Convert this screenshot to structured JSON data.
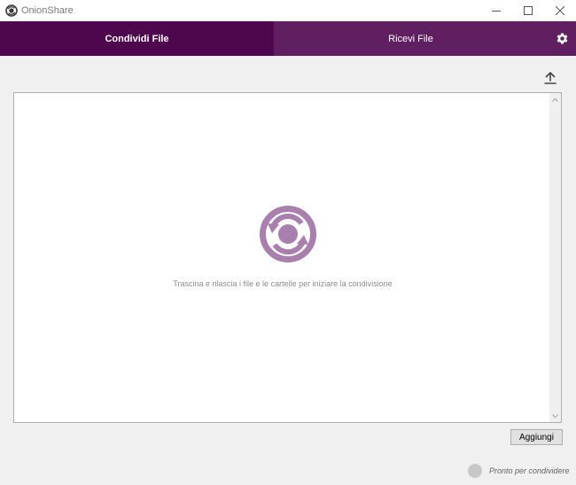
{
  "window": {
    "title": "OnionShare",
    "app_icon": "onionshare-logo-icon",
    "controls": [
      "minimize-icon",
      "maximize-icon",
      "close-icon"
    ]
  },
  "tabs": [
    {
      "label": "Condividi File",
      "active": true
    },
    {
      "label": "Ricevi File",
      "active": false
    }
  ],
  "toolbar": {
    "settings_icon": "gear-icon",
    "upload_icon": "upload-icon"
  },
  "drop_area": {
    "icon": "onionshare-logo-icon",
    "text": "Trascina e rilascia i file e le cartelle per iniziare la condivisione"
  },
  "buttons": {
    "add_label": "Aggiungi"
  },
  "status": {
    "text": "Pronto per condividere"
  },
  "colors": {
    "tab_active": "#4e064f",
    "tab_inactive": "#601f61",
    "logo": "#a97fad",
    "status_dot": "#c8c8c8"
  }
}
